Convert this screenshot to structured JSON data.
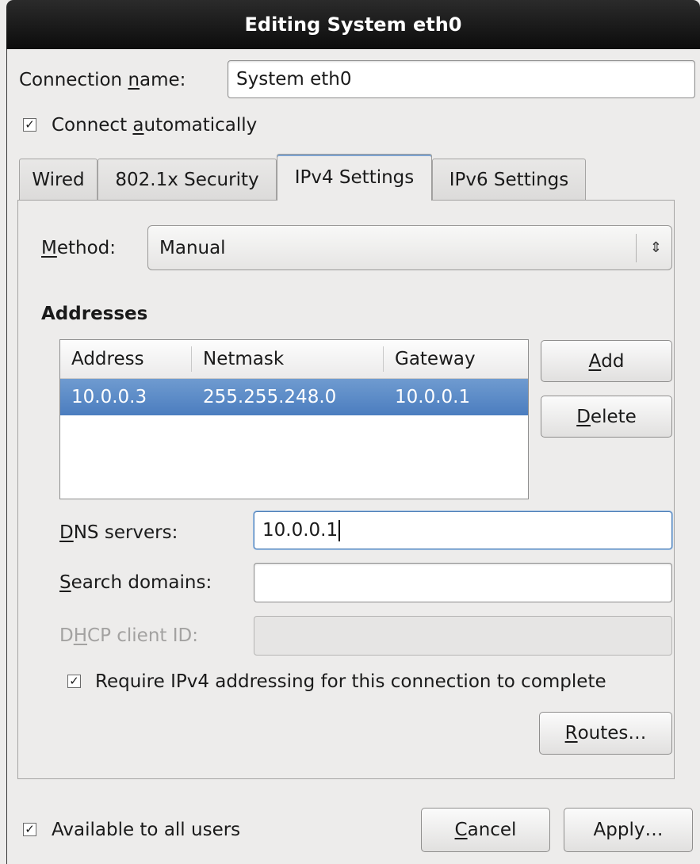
{
  "window": {
    "title": "Editing System eth0"
  },
  "connection_name": {
    "label": "Connection name:",
    "value": "System eth0"
  },
  "connect_automatically": {
    "label": "Connect automatically",
    "checked": true
  },
  "tabs": [
    {
      "label": "Wired",
      "active": false
    },
    {
      "label": "802.1x Security",
      "active": false
    },
    {
      "label": "IPv4 Settings",
      "active": true
    },
    {
      "label": "IPv6 Settings",
      "active": false
    }
  ],
  "ipv4": {
    "method": {
      "label": "Method:",
      "value": "Manual"
    },
    "addresses": {
      "heading": "Addresses",
      "columns": [
        "Address",
        "Netmask",
        "Gateway"
      ],
      "rows": [
        {
          "address": "10.0.0.3",
          "netmask": "255.255.248.0",
          "gateway": "10.0.0.1",
          "selected": true
        }
      ],
      "add_label": "Add",
      "delete_label": "Delete"
    },
    "dns_servers": {
      "label": "DNS servers:",
      "value": "10.0.0.1"
    },
    "search_domains": {
      "label": "Search domains:",
      "value": ""
    },
    "dhcp_client_id": {
      "label": "DHCP client ID:",
      "value": "",
      "enabled": false
    },
    "require_ipv4": {
      "label": "Require IPv4 addressing for this connection to complete",
      "checked": true
    },
    "routes_label": "Routes…"
  },
  "available_to_all_users": {
    "label": "Available to all users",
    "checked": true
  },
  "footer": {
    "cancel_label": "Cancel",
    "apply_label": "Apply…"
  },
  "colors": {
    "selection": "#4b7dbf",
    "titlebar": "#111111",
    "focus_border": "#4e7fb8"
  }
}
